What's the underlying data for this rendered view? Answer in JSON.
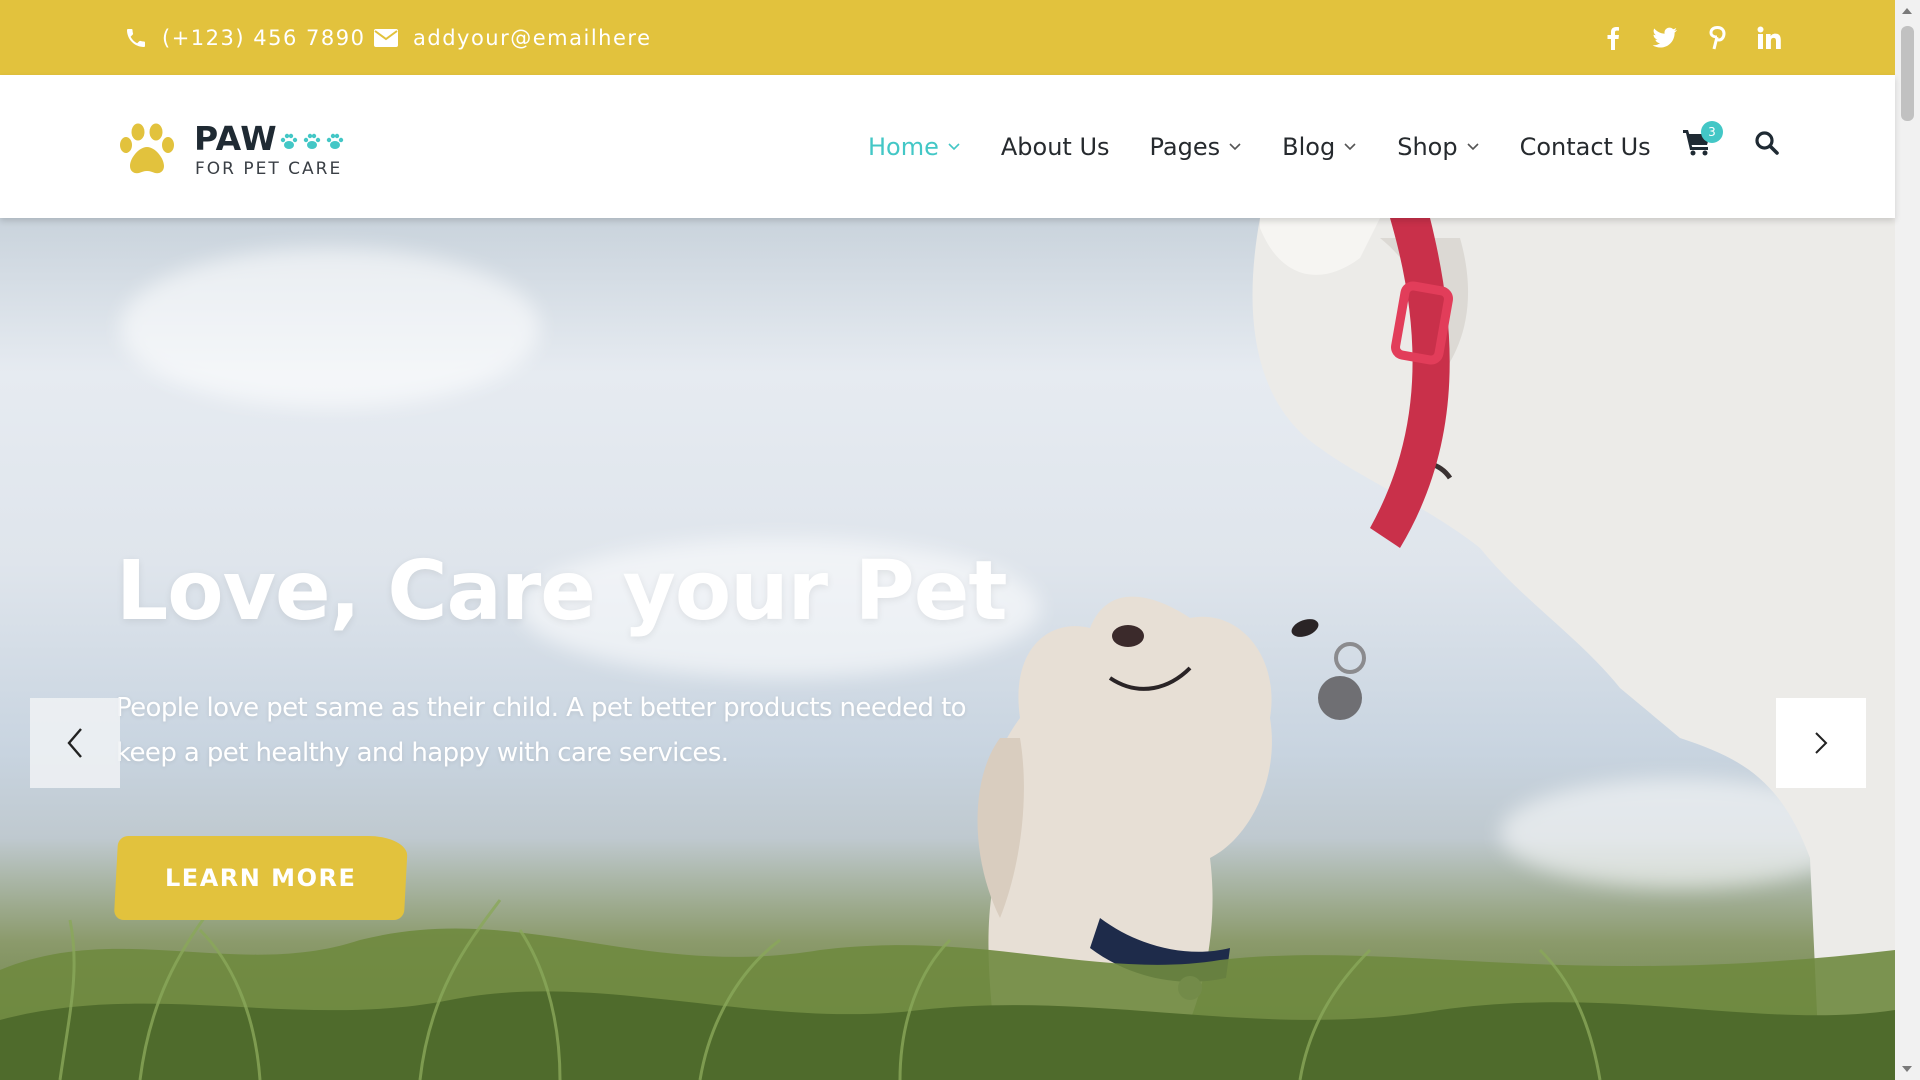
{
  "topbar": {
    "phone": "(+123) 456 7890",
    "email": "addyour@emailhere",
    "social": [
      "facebook-icon",
      "twitter-icon",
      "pinterest-icon",
      "linkedin-icon"
    ]
  },
  "logo": {
    "brand": "PAW",
    "tagline": "FOR PET CARE"
  },
  "nav": {
    "items": [
      {
        "label": "Home",
        "dropdown": true,
        "active": true
      },
      {
        "label": "About Us",
        "dropdown": false
      },
      {
        "label": "Pages",
        "dropdown": true
      },
      {
        "label": "Blog",
        "dropdown": true
      },
      {
        "label": "Shop",
        "dropdown": true
      },
      {
        "label": "Contact Us",
        "dropdown": false
      }
    ],
    "cart_count": "3"
  },
  "hero": {
    "title": "Love, Care your Pet",
    "text": "People love pet same as their child. A pet better products needed to keep a pet healthy and happy with care services.",
    "button": "LEARN MORE"
  },
  "colors": {
    "brand_yellow": "#e2c23d",
    "accent_teal": "#43c7c6",
    "text_dark": "#262a2e"
  }
}
